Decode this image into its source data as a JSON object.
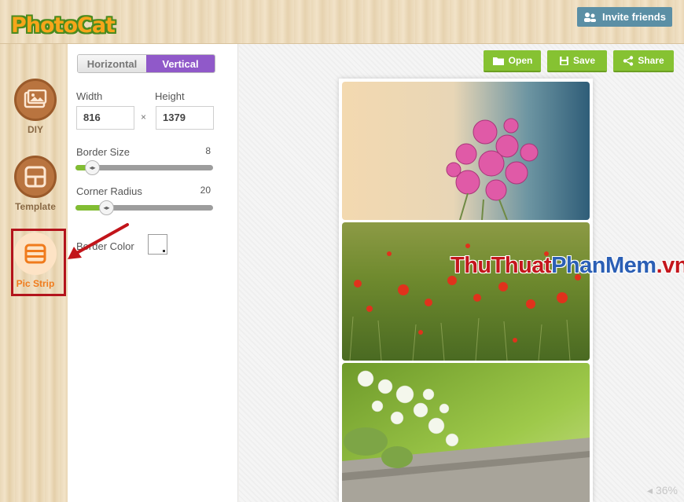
{
  "app": {
    "logo_text": "PhotoCat"
  },
  "header": {
    "invite_label": "Invite friends"
  },
  "sidebar": {
    "items": [
      {
        "label": "DIY",
        "icon": "photo-icon"
      },
      {
        "label": "Template",
        "icon": "template-icon"
      },
      {
        "label": "Pic Strip",
        "icon": "strip-icon"
      }
    ]
  },
  "panel": {
    "orientation": {
      "options": [
        "Horizontal",
        "Vertical"
      ],
      "selected": "Vertical"
    },
    "width_label": "Width",
    "height_label": "Height",
    "width_value": "816",
    "height_value": "1379",
    "times_sign": "×",
    "border_size": {
      "label": "Border Size",
      "value": "8",
      "fraction": 0.1
    },
    "corner_radius": {
      "label": "Corner Radius",
      "value": "20",
      "fraction": 0.2
    },
    "border_color_label": "Border Color"
  },
  "toolbar": {
    "open_label": "Open",
    "save_label": "Save",
    "share_label": "Share"
  },
  "canvas": {
    "zoom_label": "36%"
  },
  "watermark": {
    "part1": "ThuThuat",
    "part2": "PhanMem",
    "part3": ".vn"
  },
  "colors": {
    "accent_green": "#86c232",
    "accent_purple": "#9059c9",
    "highlight_red": "#b3141c"
  }
}
